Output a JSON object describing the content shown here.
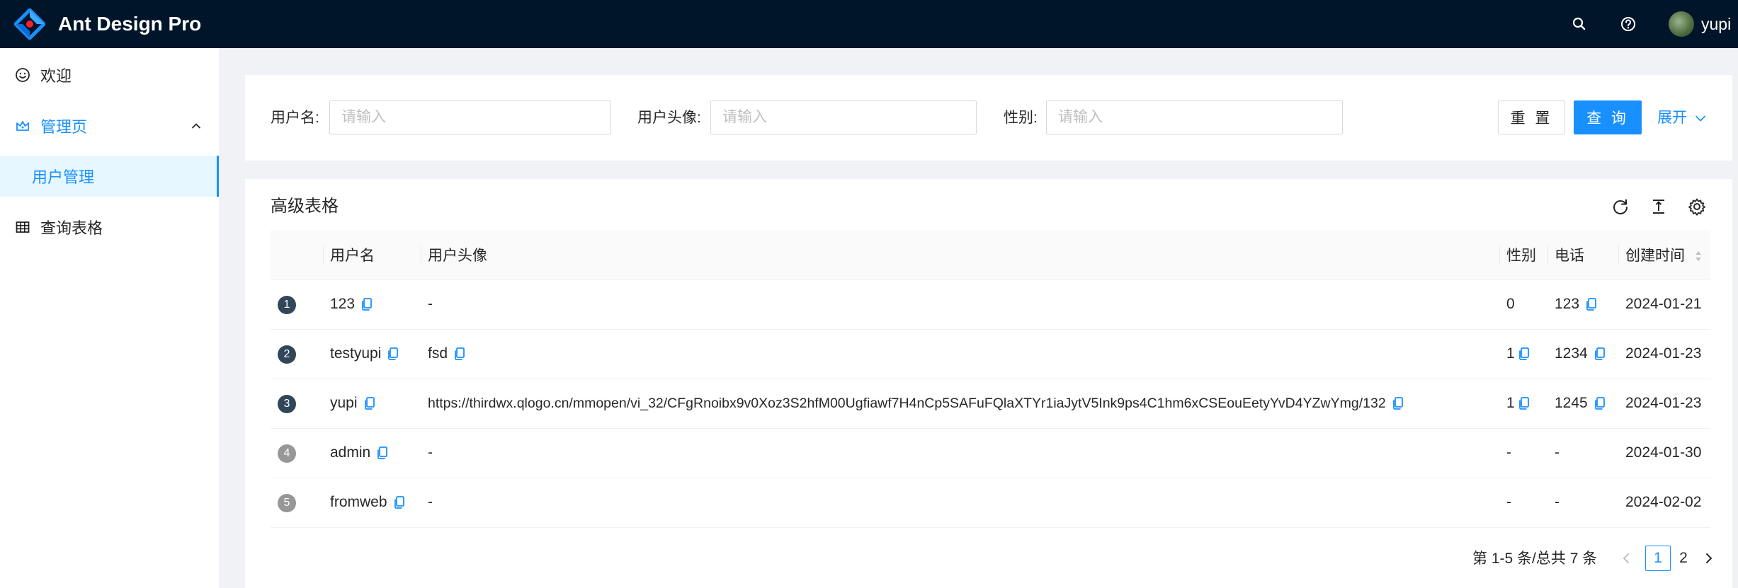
{
  "header": {
    "title": "Ant Design Pro",
    "icons": [
      "search-icon",
      "question-circle-icon"
    ],
    "user_name": "yupi",
    "colors": {
      "background": "#001529",
      "text": "#ffffff"
    }
  },
  "sidebar": {
    "items": [
      {
        "label": "欢迎",
        "icon": "smile-icon"
      },
      {
        "label": "管理页",
        "icon": "crown-icon",
        "expanded": true
      },
      {
        "label": "用户管理",
        "selected": true
      },
      {
        "label": "查询表格",
        "icon": "table-icon"
      }
    ],
    "colors": {
      "accent": "#1890ff",
      "selected_bg": "#e6f7ff"
    }
  },
  "search": {
    "fields": [
      {
        "label": "用户名",
        "placeholder": "请输入",
        "value": ""
      },
      {
        "label": "用户头像",
        "placeholder": "请输入",
        "value": ""
      },
      {
        "label": "性别",
        "placeholder": "请输入",
        "value": ""
      }
    ],
    "reset_label": "重 置",
    "query_label": "查 询",
    "expand_label": "展开"
  },
  "table": {
    "title": "高级表格",
    "toolbar_icons": [
      "reload-icon",
      "column-height-icon",
      "setting-icon"
    ],
    "columns": [
      "",
      "用户名",
      "用户头像",
      "性别",
      "电话",
      "创建时间"
    ],
    "rows": [
      {
        "index": "1",
        "username": "123",
        "avatar": "-",
        "gender": "0",
        "phone": "123",
        "created": "2024-01-21"
      },
      {
        "index": "2",
        "username": "testyupi",
        "avatar": "fsd",
        "gender": "1",
        "phone": "1234",
        "created": "2024-01-23"
      },
      {
        "index": "3",
        "username": "yupi",
        "avatar": "https://thirdwx.qlogo.cn/mmopen/vi_32/CFgRnoibx9v0Xoz3S2hfM00Ugfiawf7H4nCp5SAFuFQlaXTYr1iaJytV5Ink9ps4C1hm6xCSEouEetyYvD4YZwYmg/132",
        "gender": "1",
        "phone": "1245",
        "created": "2024-01-23"
      },
      {
        "index": "4",
        "username": "admin",
        "avatar": "-",
        "gender": "-",
        "phone": "-",
        "created": "2024-01-30"
      },
      {
        "index": "5",
        "username": "fromweb",
        "avatar": "-",
        "gender": "-",
        "phone": "-",
        "created": "2024-02-02"
      }
    ],
    "pagination": {
      "total_text": "第 1-5 条/总共 7 条",
      "pages": [
        "1",
        "2"
      ],
      "current": "1"
    }
  }
}
